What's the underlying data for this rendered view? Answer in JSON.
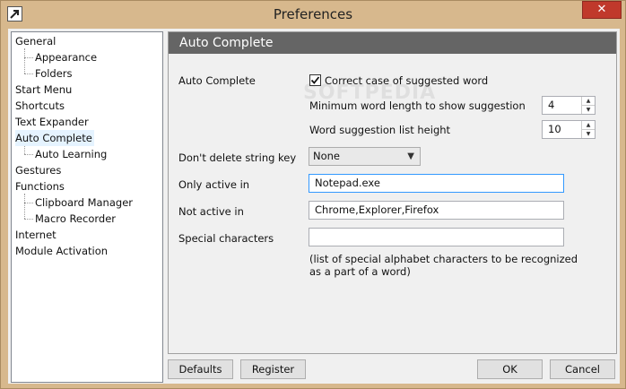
{
  "window": {
    "title": "Preferences",
    "close_glyph": "✕",
    "accent": "#d7b88d",
    "close_color": "#c0392b",
    "app_icon": "arrow-icon"
  },
  "tree": {
    "items": [
      {
        "label": "General",
        "level": 0
      },
      {
        "label": "Appearance",
        "level": 1
      },
      {
        "label": "Folders",
        "level": 1
      },
      {
        "label": "Start Menu",
        "level": 0
      },
      {
        "label": "Shortcuts",
        "level": 0
      },
      {
        "label": "Text Expander",
        "level": 0
      },
      {
        "label": "Auto Complete",
        "level": 0,
        "selected": true
      },
      {
        "label": "Auto Learning",
        "level": 1
      },
      {
        "label": "Gestures",
        "level": 0
      },
      {
        "label": "Functions",
        "level": 0
      },
      {
        "label": "Clipboard Manager",
        "level": 1
      },
      {
        "label": "Macro Recorder",
        "level": 1
      },
      {
        "label": "Internet",
        "level": 0
      },
      {
        "label": "Module Activation",
        "level": 0
      }
    ]
  },
  "panel": {
    "header": "Auto Complete",
    "watermark": "SOFTPEDIA",
    "auto_complete_label": "Auto Complete",
    "correct_case_label": "Correct case of suggested word",
    "correct_case_checked": true,
    "min_length_label": "Minimum word length to show suggestion",
    "min_length_value": "4",
    "list_height_label": "Word suggestion list height",
    "list_height_value": "10",
    "dont_delete_label": "Don't delete string key",
    "dont_delete_value": "None",
    "only_active_label": "Only active in",
    "only_active_value": "Notepad.exe",
    "not_active_label": "Not active in",
    "not_active_value": "Chrome,Explorer,Firefox",
    "special_chars_label": "Special characters",
    "special_chars_value": "",
    "special_chars_hint_1": "(list of special alphabet characters to be recognized",
    "special_chars_hint_2": "as a part of a word)"
  },
  "buttons": {
    "defaults": "Defaults",
    "register": "Register",
    "ok": "OK",
    "cancel": "Cancel"
  }
}
